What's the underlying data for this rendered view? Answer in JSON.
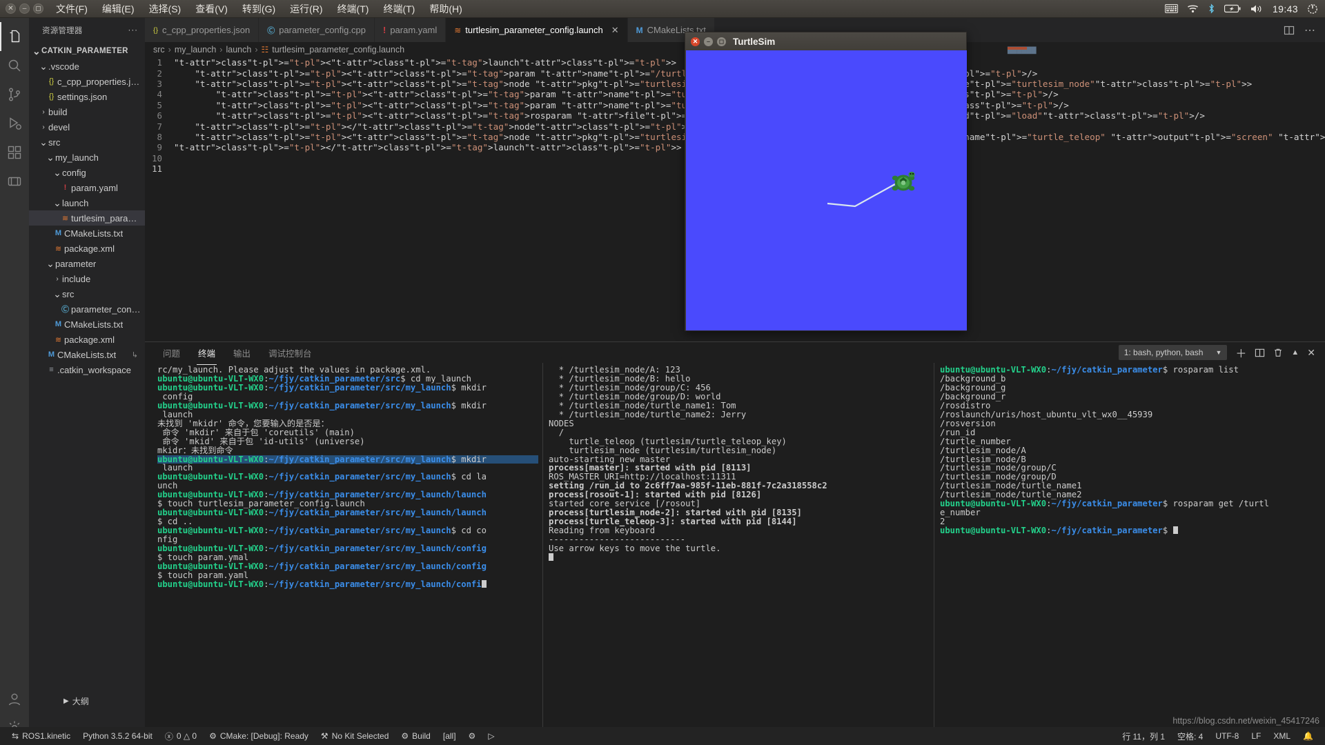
{
  "topbar": {
    "window_buttons": [
      "close",
      "minimize",
      "maximize"
    ],
    "menus": [
      "文件(F)",
      "编辑(E)",
      "选择(S)",
      "查看(V)",
      "转到(G)",
      "运行(R)",
      "终端(T)",
      "终端(T)",
      "帮助(H)"
    ],
    "tray_icons": [
      "keyboard-icon",
      "wifi-icon",
      "bluetooth-icon",
      "battery-icon",
      "volume-icon"
    ],
    "clock": "19:43",
    "power_icon": "power-gear-icon"
  },
  "activity_bar": {
    "items": [
      {
        "name": "explorer",
        "icon": "files-icon",
        "active": true
      },
      {
        "name": "search",
        "icon": "search-icon",
        "active": false
      },
      {
        "name": "source-control",
        "icon": "source-control-icon",
        "active": false
      },
      {
        "name": "run-debug",
        "icon": "run-debug-icon",
        "active": false
      },
      {
        "name": "extensions",
        "icon": "extensions-icon",
        "active": false
      },
      {
        "name": "ros",
        "icon": "ros-icon",
        "active": false
      }
    ],
    "bottom_items": [
      {
        "name": "accounts",
        "icon": "account-icon"
      },
      {
        "name": "settings",
        "icon": "gear-icon"
      }
    ]
  },
  "sidebar": {
    "title": "资源管理器",
    "more_label": "···",
    "tree": [
      {
        "label": "CATKIN_PARAMETER",
        "depth": 0,
        "kind": "root",
        "chevron": "down"
      },
      {
        "label": ".vscode",
        "depth": 1,
        "kind": "folder",
        "chevron": "down"
      },
      {
        "label": "c_cpp_properties.json",
        "depth": 2,
        "kind": "json"
      },
      {
        "label": "settings.json",
        "depth": 2,
        "kind": "json"
      },
      {
        "label": "build",
        "depth": 1,
        "kind": "folder",
        "chevron": "right"
      },
      {
        "label": "devel",
        "depth": 1,
        "kind": "folder",
        "chevron": "right"
      },
      {
        "label": "src",
        "depth": 1,
        "kind": "folder",
        "chevron": "down"
      },
      {
        "label": "my_launch",
        "depth": 2,
        "kind": "folder",
        "chevron": "down"
      },
      {
        "label": "config",
        "depth": 3,
        "kind": "folder",
        "chevron": "down"
      },
      {
        "label": "param.yaml",
        "depth": 4,
        "kind": "yaml"
      },
      {
        "label": "launch",
        "depth": 3,
        "kind": "folder",
        "chevron": "down"
      },
      {
        "label": "turtlesim_parameter_c...",
        "depth": 4,
        "kind": "xml",
        "selected": true
      },
      {
        "label": "CMakeLists.txt",
        "depth": 3,
        "kind": "cmake"
      },
      {
        "label": "package.xml",
        "depth": 3,
        "kind": "xml"
      },
      {
        "label": "parameter",
        "depth": 2,
        "kind": "folder",
        "chevron": "down"
      },
      {
        "label": "include",
        "depth": 3,
        "kind": "folder",
        "chevron": "right"
      },
      {
        "label": "src",
        "depth": 3,
        "kind": "folder",
        "chevron": "down"
      },
      {
        "label": "parameter_config.cpp",
        "depth": 4,
        "kind": "cpp"
      },
      {
        "label": "CMakeLists.txt",
        "depth": 3,
        "kind": "cmake"
      },
      {
        "label": "package.xml",
        "depth": 3,
        "kind": "xml"
      },
      {
        "label": "CMakeLists.txt",
        "depth": 2,
        "kind": "cmake",
        "trail": "↳"
      },
      {
        "label": ".catkin_workspace",
        "depth": 2,
        "kind": "plain"
      }
    ],
    "outline_label": "大纲"
  },
  "editor": {
    "tabs": [
      {
        "label": "c_cpp_properties.json",
        "icon": "json-icon",
        "active": false,
        "closable": false
      },
      {
        "label": "parameter_config.cpp",
        "icon": "cpp-icon",
        "active": false,
        "closable": false
      },
      {
        "label": "param.yaml",
        "icon": "yaml-icon",
        "active": false,
        "closable": false
      },
      {
        "label": "turtlesim_parameter_config.launch",
        "icon": "xml-icon",
        "active": true,
        "closable": true
      },
      {
        "label": "CMakeLists.txt",
        "icon": "cmake-icon",
        "active": false,
        "closable": false
      }
    ],
    "tab_actions": [
      "split-editor-icon",
      "more-actions-icon"
    ],
    "breadcrumb": [
      "src",
      "my_launch",
      "launch",
      "turtlesim_parameter_config.launch"
    ],
    "line_numbers": [
      1,
      2,
      3,
      4,
      5,
      6,
      7,
      8,
      9,
      10,
      11
    ],
    "code_lines": [
      "<launch>",
      "    <param name=\"/turtle_number\" value=\"2\" />",
      "    <node pkg=\"turtlesim\" type=\"turtlesim_node\" name=\"turtlesim_node\">",
      "        <param name=\"turtle_name1\" value=\"Tom\" />",
      "        <param name=\"turtle_name2\" value=\"Jerry\" />",
      "        <rosparam file=\"$(find my_launch)/config/param.yaml\" command=\"load\"/>",
      "    </node>",
      "    <node pkg=\"turtlesim\" type=\"turtle_teleop_key\" name=\"turtle_teleop\" output=\"screen\" />",
      "</launch>",
      "",
      ""
    ]
  },
  "turtlesim": {
    "title": "TurtleSim",
    "canvas_color": "#4a4afd",
    "buttons": [
      "close",
      "minimize",
      "maximize"
    ]
  },
  "panel": {
    "tabs": [
      "问题",
      "终端",
      "输出",
      "调试控制台"
    ],
    "active_tab": "终端",
    "terminal_selector": "1: bash, python, bash",
    "actions": [
      "new-terminal-icon",
      "split-terminal-icon",
      "kill-terminal-icon",
      "chevron-up-icon",
      "close-panel-icon"
    ],
    "columns": [
      [
        {
          "t": "plain",
          "v": "rc/my_launch. Please adjust the values in package.xml."
        },
        {
          "t": "prompt",
          "user": "ubuntu@ubuntu-VLT-WX0",
          "path": "~/fjy/catkin_parameter/src",
          "cmd": "$ cd my_launch"
        },
        {
          "t": "prompt",
          "user": "ubuntu@ubuntu-VLT-WX0",
          "path": "~/fjy/catkin_parameter/src/my_launch",
          "cmd": "$ mkdir"
        },
        {
          "t": "plain",
          "v": " config"
        },
        {
          "t": "prompt",
          "user": "ubuntu@ubuntu-VLT-WX0",
          "path": "~/fjy/catkin_parameter/src/my_launch",
          "cmd": "$ mkdir"
        },
        {
          "t": "plain",
          "v": " launch"
        },
        {
          "t": "plain",
          "v": "未找到 'mkidr' 命令，您要输入的是否是："
        },
        {
          "t": "plain",
          "v": " 命令 'mkdir' 来自于包 'coreutils' (main)"
        },
        {
          "t": "plain",
          "v": " 命令 'mkid' 来自于包 'id-utils' (universe)"
        },
        {
          "t": "plain",
          "v": "mkidr：未找到命令"
        },
        {
          "t": "prompt",
          "user": "ubuntu@ubuntu-VLT-WX0",
          "path": "~/fjy/catkin_parameter/src/my_launch",
          "cmd": "$ mkdir",
          "hl": true
        },
        {
          "t": "plain",
          "v": " launch"
        },
        {
          "t": "prompt",
          "user": "ubuntu@ubuntu-VLT-WX0",
          "path": "~/fjy/catkin_parameter/src/my_launch",
          "cmd": "$ cd la"
        },
        {
          "t": "plain",
          "v": "unch"
        },
        {
          "t": "prompt",
          "user": "ubuntu@ubuntu-VLT-WX0",
          "path": "~/fjy/catkin_parameter/src/my_launch/launch",
          "cmd": ""
        },
        {
          "t": "plain",
          "v": "$ touch turtlesim_parameter_config.launch"
        },
        {
          "t": "prompt",
          "user": "ubuntu@ubuntu-VLT-WX0",
          "path": "~/fjy/catkin_parameter/src/my_launch/launch",
          "cmd": ""
        },
        {
          "t": "plain",
          "v": "$ cd .."
        },
        {
          "t": "prompt",
          "user": "ubuntu@ubuntu-VLT-WX0",
          "path": "~/fjy/catkin_parameter/src/my_launch",
          "cmd": "$ cd co"
        },
        {
          "t": "plain",
          "v": "nfig"
        },
        {
          "t": "prompt",
          "user": "ubuntu@ubuntu-VLT-WX0",
          "path": "~/fjy/catkin_parameter/src/my_launch/config",
          "cmd": ""
        },
        {
          "t": "plain",
          "v": "$ touch param.ymal"
        },
        {
          "t": "prompt",
          "user": "ubuntu@ubuntu-VLT-WX0",
          "path": "~/fjy/catkin_parameter/src/my_launch/config",
          "cmd": ""
        },
        {
          "t": "plain",
          "v": "$ touch param.yaml"
        },
        {
          "t": "prompt",
          "user": "ubuntu@ubuntu-VLT-WX0",
          "path": "~/fjy/catkin_parameter/src/my_launch/confi",
          "cmd": "",
          "cursor": true
        }
      ],
      [
        {
          "t": "plain",
          "v": "  * /turtlesim_node/A: 123"
        },
        {
          "t": "plain",
          "v": "  * /turtlesim_node/B: hello"
        },
        {
          "t": "plain",
          "v": "  * /turtlesim_node/group/C: 456"
        },
        {
          "t": "plain",
          "v": "  * /turtlesim_node/group/D: world"
        },
        {
          "t": "plain",
          "v": "  * /turtlesim_node/turtle_name1: Tom"
        },
        {
          "t": "plain",
          "v": "  * /turtlesim_node/turtle_name2: Jerry"
        },
        {
          "t": "plain",
          "v": ""
        },
        {
          "t": "plain",
          "v": "NODES"
        },
        {
          "t": "plain",
          "v": "  /"
        },
        {
          "t": "plain",
          "v": "    turtle_teleop (turtlesim/turtle_teleop_key)"
        },
        {
          "t": "plain",
          "v": "    turtlesim_node (turtlesim/turtlesim_node)"
        },
        {
          "t": "plain",
          "v": ""
        },
        {
          "t": "plain",
          "v": "auto-starting new master"
        },
        {
          "t": "bold",
          "v": "process[master]: started with pid [8113]"
        },
        {
          "t": "plain",
          "v": "ROS_MASTER_URI=http://localhost:11311"
        },
        {
          "t": "plain",
          "v": ""
        },
        {
          "t": "bold",
          "v": "setting /run_id to 2c6ff7aa-985f-11eb-881f-7c2a318558c2"
        },
        {
          "t": "bold",
          "v": "process[rosout-1]: started with pid [8126]"
        },
        {
          "t": "plain",
          "v": "started core service [/rosout]"
        },
        {
          "t": "bold",
          "v": "process[turtlesim_node-2]: started with pid [8135]"
        },
        {
          "t": "bold",
          "v": "process[turtle_teleop-3]: started with pid [8144]"
        },
        {
          "t": "plain",
          "v": "Reading from keyboard"
        },
        {
          "t": "plain",
          "v": "---------------------------"
        },
        {
          "t": "plain",
          "v": "Use arrow keys to move the turtle."
        },
        {
          "t": "plain",
          "v": "",
          "cursor": true
        }
      ],
      [
        {
          "t": "prompt",
          "user": "ubuntu@ubuntu-VLT-WX0",
          "path": "~/fjy/catkin_parameter",
          "cmd": "$ rosparam list"
        },
        {
          "t": "plain",
          "v": "/background_b"
        },
        {
          "t": "plain",
          "v": "/background_g"
        },
        {
          "t": "plain",
          "v": "/background_r"
        },
        {
          "t": "plain",
          "v": "/rosdistro"
        },
        {
          "t": "plain",
          "v": "/roslaunch/uris/host_ubuntu_vlt_wx0__45939"
        },
        {
          "t": "plain",
          "v": "/rosversion"
        },
        {
          "t": "plain",
          "v": "/run_id"
        },
        {
          "t": "plain",
          "v": "/turtle_number"
        },
        {
          "t": "plain",
          "v": "/turtlesim_node/A"
        },
        {
          "t": "plain",
          "v": "/turtlesim_node/B"
        },
        {
          "t": "plain",
          "v": "/turtlesim_node/group/C"
        },
        {
          "t": "plain",
          "v": "/turtlesim_node/group/D"
        },
        {
          "t": "plain",
          "v": "/turtlesim_node/turtle_name1"
        },
        {
          "t": "plain",
          "v": "/turtlesim_node/turtle_name2"
        },
        {
          "t": "prompt",
          "user": "ubuntu@ubuntu-VLT-WX0",
          "path": "~/fjy/catkin_parameter",
          "cmd": "$ rosparam get /turtl"
        },
        {
          "t": "plain",
          "v": "e_number"
        },
        {
          "t": "plain",
          "v": "2"
        },
        {
          "t": "prompt",
          "user": "ubuntu@ubuntu-VLT-WX0",
          "path": "~/fjy/catkin_parameter",
          "cmd": "$ ",
          "cursor": true
        }
      ]
    ]
  },
  "statusbar": {
    "left": [
      {
        "icon": "remote-icon",
        "label": "ROS1.kinetic"
      },
      {
        "icon": "",
        "label": "Python 3.5.2 64-bit"
      },
      {
        "icon": "error-warn-icon",
        "label": "0 △ 0"
      },
      {
        "icon": "cmake-icon",
        "label": "CMake: [Debug]: Ready"
      },
      {
        "icon": "wrench-icon",
        "label": "No Kit Selected"
      },
      {
        "icon": "gear-icon",
        "label": "Build"
      },
      {
        "icon": "",
        "label": "[all]"
      },
      {
        "icon": "debug-gear-icon",
        "label": ""
      },
      {
        "icon": "play-icon",
        "label": ""
      }
    ],
    "right": [
      {
        "label": "行 11，列 1"
      },
      {
        "label": "空格: 4"
      },
      {
        "label": "UTF-8"
      },
      {
        "label": "LF"
      },
      {
        "label": "XML"
      },
      {
        "label": "🔔"
      }
    ],
    "watermark": "https://blog.csdn.net/weixin_45417246"
  }
}
